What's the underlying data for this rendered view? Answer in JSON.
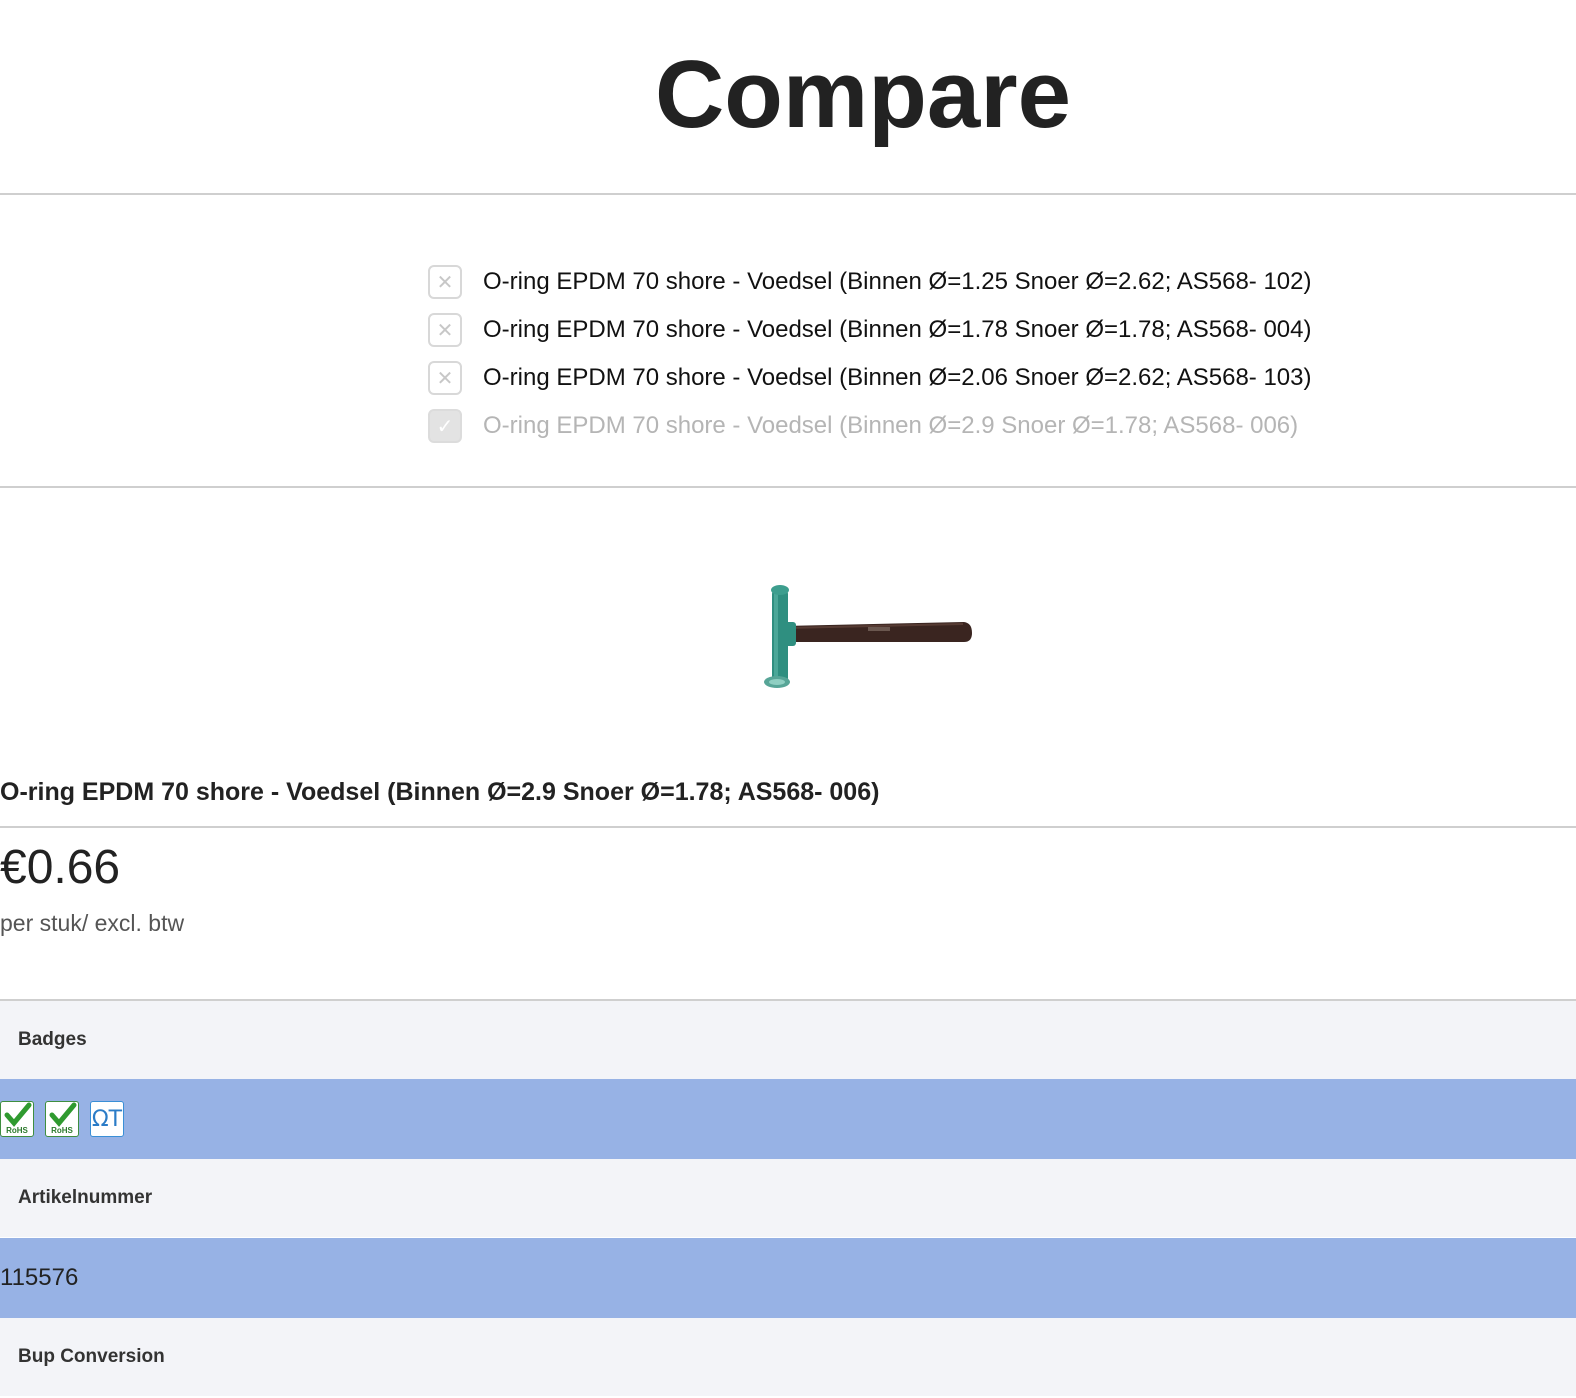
{
  "page": {
    "title": "Compare"
  },
  "selector": {
    "items": [
      {
        "label": "O-ring EPDM 70 shore - Voedsel (Binnen Ø=1.25 Snoer Ø=2.62; AS568- 102)",
        "state": "remove"
      },
      {
        "label": "O-ring EPDM 70 shore - Voedsel (Binnen Ø=1.78 Snoer Ø=1.78; AS568- 004)",
        "state": "remove"
      },
      {
        "label": "O-ring EPDM 70 shore - Voedsel (Binnen Ø=2.06 Snoer Ø=2.62; AS568- 103)",
        "state": "remove"
      },
      {
        "label": "O-ring EPDM 70 shore - Voedsel (Binnen Ø=2.9 Snoer Ø=1.78; AS568- 006)",
        "state": "selected"
      }
    ],
    "remove_icon": "close-icon",
    "selected_icon": "check-icon"
  },
  "product": {
    "image_icon": "hammer-image",
    "name": "O-ring EPDM 70 shore - Voedsel (Binnen Ø=2.9 Snoer Ø=1.78; AS568- 006)",
    "price": "€0.66",
    "price_note": "per stuk/ excl. btw"
  },
  "attributes": {
    "badges_label": "Badges",
    "badges": [
      {
        "icon": "rohs-badge-icon",
        "text": "RoHS"
      },
      {
        "icon": "rohs-badge-icon",
        "text": "RoHS"
      },
      {
        "icon": "qt-badge-icon",
        "text": "ΩT"
      }
    ],
    "artikelnummer_label": "Artikelnummer",
    "artikelnummer_value": "115576",
    "bup_label": "Bup Conversion"
  },
  "colors": {
    "value_row": "#97b2e5",
    "header_row": "#f3f4f8",
    "rohs_green": "#3f8e3f",
    "qt_blue": "#3a8fd6"
  }
}
